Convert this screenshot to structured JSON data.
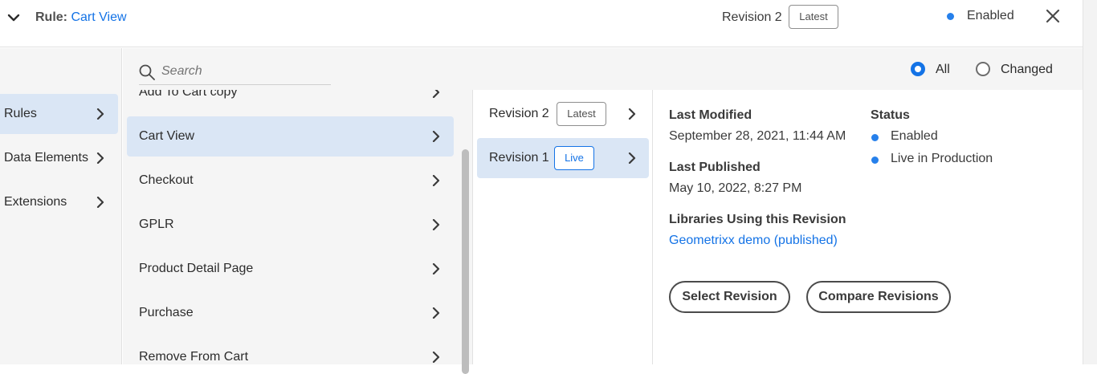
{
  "header": {
    "rule_prefix": "Rule:",
    "rule_name": "Cart View",
    "revision_label": "Revision 2",
    "revision_badge": "Latest",
    "status": "Enabled"
  },
  "sidebar": {
    "items": [
      {
        "label": "Rules"
      },
      {
        "label": "Data Elements"
      },
      {
        "label": "Extensions"
      }
    ]
  },
  "rules_list": {
    "search_placeholder": "Search",
    "items": [
      {
        "label": "Add To Cart copy"
      },
      {
        "label": "Cart View"
      },
      {
        "label": "Checkout"
      },
      {
        "label": "GPLR"
      },
      {
        "label": "Product Detail Page"
      },
      {
        "label": "Purchase"
      },
      {
        "label": "Remove From Cart"
      }
    ]
  },
  "filter": {
    "all_label": "All",
    "changed_label": "Changed",
    "selected": "All"
  },
  "revisions": {
    "items": [
      {
        "label": "Revision 2",
        "badge": "Latest"
      },
      {
        "label": "Revision 1",
        "badge": "Live"
      }
    ]
  },
  "details": {
    "last_modified_label": "Last Modified",
    "last_modified_value": "September 28, 2021, 11:44 AM",
    "last_published_label": "Last Published",
    "last_published_value": "May 10, 2022, 8:27 PM",
    "libraries_label": "Libraries Using this Revision",
    "library_link": "Geometrixx demo (published)",
    "status_label": "Status",
    "status_values": [
      "Enabled",
      "Live in Production"
    ],
    "select_button": "Select Revision",
    "compare_button": "Compare Revisions"
  },
  "colors": {
    "accent": "#1473e6",
    "selected_bg": "#dae6f5",
    "status_dot": "#2680eb"
  }
}
